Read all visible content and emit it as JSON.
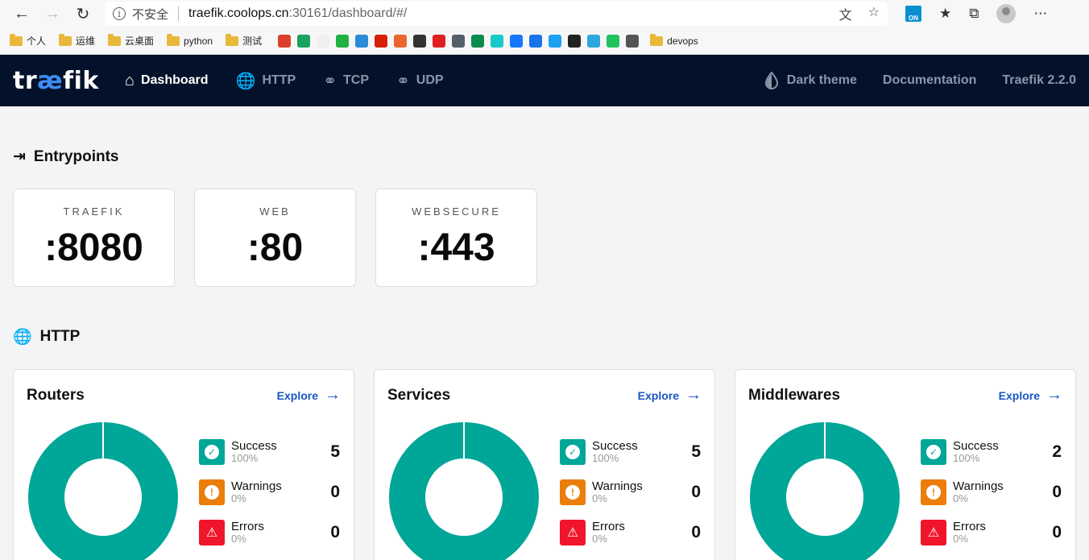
{
  "browser": {
    "insecure_label": "不安全",
    "url_host": "traefik.coolops.cn",
    "url_path": ":30161/dashboard/#/",
    "ext_badge": "ON",
    "bookmarks": [
      {
        "label": "个人"
      },
      {
        "label": "运维"
      },
      {
        "label": "云桌面"
      },
      {
        "label": "python"
      },
      {
        "label": "测试"
      }
    ],
    "bookmark_last": "devops",
    "bookmark_icon_colors": [
      "#d9412b",
      "#1aa260",
      "#f0f0f0",
      "#1fb141",
      "#2a8bd6",
      "#d81e06",
      "#e9662c",
      "#333333",
      "#e02020",
      "#555f6a",
      "#0c8b4f",
      "#19c8c8",
      "#1677ff",
      "#1a73e8",
      "#1da1f2",
      "#222222",
      "#2ea7e0",
      "#21c25e",
      "#555555"
    ]
  },
  "nav": {
    "logo_left": "tr",
    "logo_mid": "æ",
    "logo_right": "fik",
    "items": [
      {
        "label": "Dashboard"
      },
      {
        "label": "HTTP"
      },
      {
        "label": "TCP"
      },
      {
        "label": "UDP"
      }
    ],
    "dark_theme": "Dark theme",
    "documentation": "Documentation",
    "version": "Traefik 2.2.0"
  },
  "entrypoints": {
    "title": "Entrypoints",
    "items": [
      {
        "name": "TRAEFIK",
        "port": ":8080"
      },
      {
        "name": "WEB",
        "port": ":80"
      },
      {
        "name": "WEBSECURE",
        "port": ":443"
      }
    ]
  },
  "http": {
    "title": "HTTP",
    "explore_label": "Explore",
    "cards": [
      {
        "title": "Routers",
        "success": {
          "label": "Success",
          "pct": "100%",
          "count": "5"
        },
        "warnings": {
          "label": "Warnings",
          "pct": "0%",
          "count": "0"
        },
        "errors": {
          "label": "Errors",
          "pct": "0%",
          "count": "0"
        }
      },
      {
        "title": "Services",
        "success": {
          "label": "Success",
          "pct": "100%",
          "count": "5"
        },
        "warnings": {
          "label": "Warnings",
          "pct": "0%",
          "count": "0"
        },
        "errors": {
          "label": "Errors",
          "pct": "0%",
          "count": "0"
        }
      },
      {
        "title": "Middlewares",
        "success": {
          "label": "Success",
          "pct": "100%",
          "count": "2"
        },
        "warnings": {
          "label": "Warnings",
          "pct": "0%",
          "count": "0"
        },
        "errors": {
          "label": "Errors",
          "pct": "0%",
          "count": "0"
        }
      }
    ]
  },
  "colors": {
    "nav_bg": "#04112a",
    "success": "#00a698",
    "warning": "#eb7e0a",
    "error": "#f0152b",
    "link": "#1a56c4"
  }
}
